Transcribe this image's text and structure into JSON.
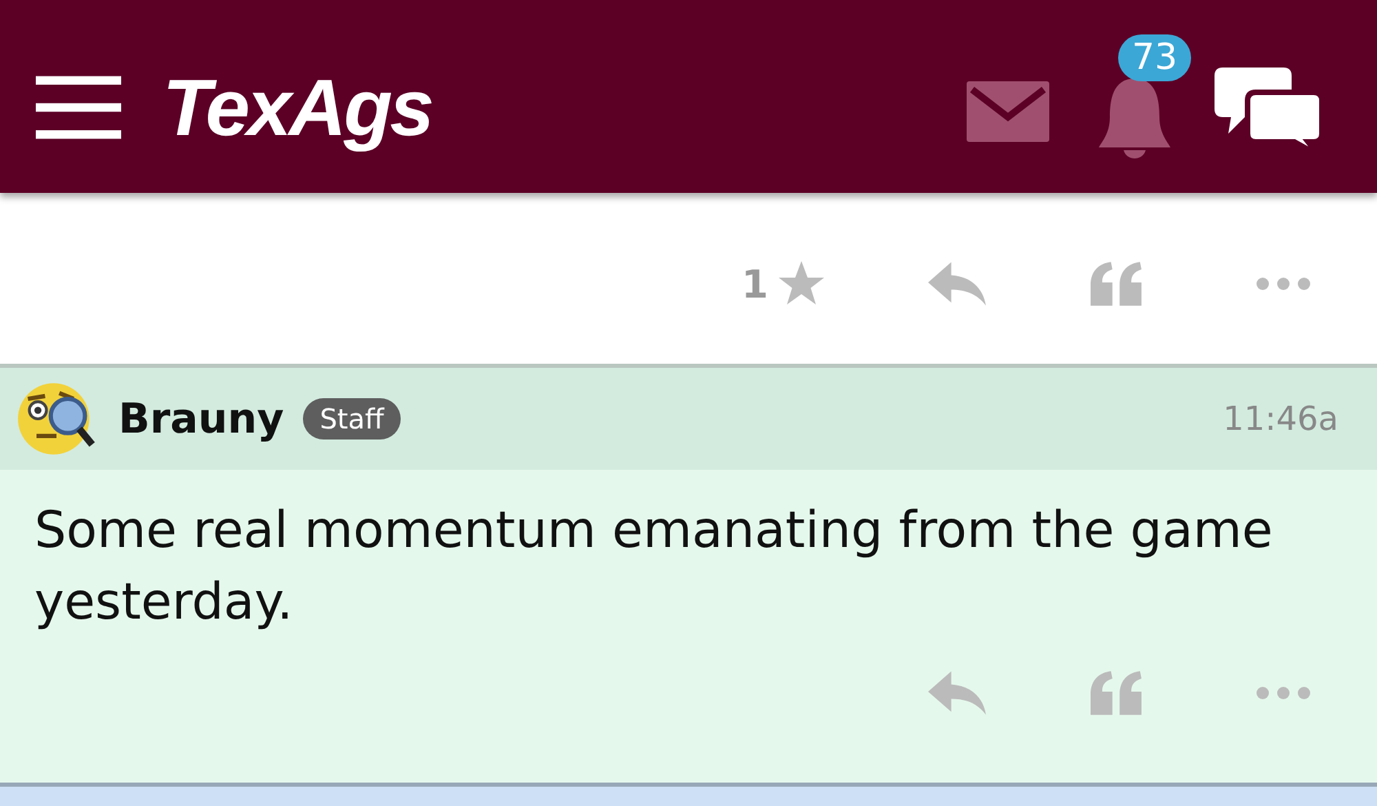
{
  "header": {
    "logo": "TexAgs",
    "notification_count": "73"
  },
  "posts": [
    {
      "kind": "tail",
      "star_count": "1"
    },
    {
      "kind": "full",
      "author": "Brauny",
      "badge": "Staff",
      "time": "11:46a",
      "text": "Some real momentum emanating from the game yesterday."
    }
  ]
}
